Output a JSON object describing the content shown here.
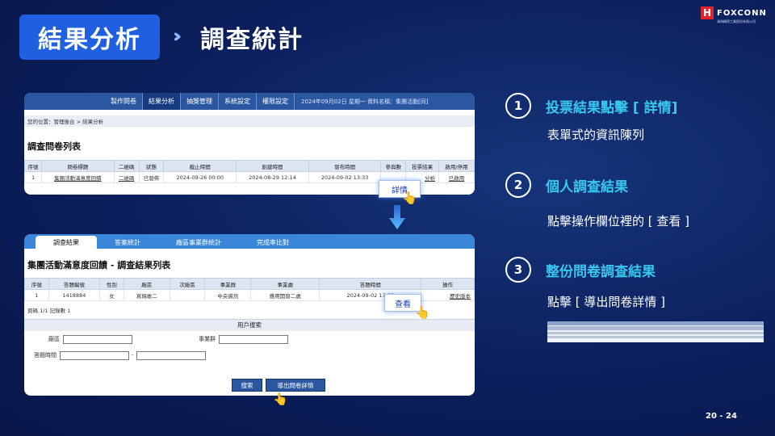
{
  "header": {
    "title": "結果分析",
    "subtitle": "調查統計",
    "logo_mark": "H",
    "logo_text": "FOXCONN",
    "logo_sub": "鴻海精密工業股份有限公司"
  },
  "panel1": {
    "nav": [
      "製作問卷",
      "結果分析",
      "抽獎管理",
      "系統設定",
      "權限設定"
    ],
    "info": "2024年09月02日 星期一  資料名稱：集團活動[同]",
    "breadcrumb": "您的位置：管理後台 > 結果分析",
    "section_title": "調查問卷列表",
    "columns": [
      "序號",
      "問卷標題",
      "二維碼",
      "狀態",
      "截止時間",
      "創建時間",
      "發布時間",
      "參與數",
      "投票結果",
      "啟用/停用"
    ],
    "row": [
      "1",
      "集團活動滿意度回饋",
      "二維碼",
      "已發佈",
      "2024-09-26 00:00",
      "2024-08-29 12:14",
      "2024-09-02 13:33",
      "",
      "分析",
      "已啟用"
    ],
    "callout": "詳情"
  },
  "panel2": {
    "tabs": [
      "調查結果",
      "答案統計",
      "廠區事業群統計",
      "完成率比對"
    ],
    "section_title": "集團活動滿意度回饋 - 調查結果列表",
    "columns": [
      "序號",
      "答題編號",
      "性別",
      "廠區",
      "次廠區",
      "事業群",
      "事業處",
      "答題時間",
      "操作"
    ],
    "row": [
      "1",
      "1418884",
      "女",
      "寫錫敢二",
      "",
      "中央資訊",
      "應用開發二處",
      "2024-09-02 17:39",
      "歷史版本"
    ],
    "record_count": "頁碼 1/1 記錄數 1",
    "search_title": "用戶搜索",
    "labels": {
      "id": "廠區",
      "unit": "事業群",
      "time": "答題時間"
    },
    "buttons": {
      "search": "搜索",
      "export": "導出問卷詳情"
    },
    "callout": "查看"
  },
  "steps": [
    {
      "num": "1",
      "title": "投票結果點擊 [ 詳情]",
      "desc": "表單式的資訊陳列"
    },
    {
      "num": "2",
      "title": "個人調查結果",
      "desc": "點擊操作欄位裡的 [ 查看 ]"
    },
    {
      "num": "3",
      "title": "整份問卷調查結果",
      "desc": "點擊 [ 導出問卷詳情 ]"
    }
  ],
  "page_number": "20 - 24",
  "colors": {
    "accent": "#36c8f0",
    "title_box": "#1f5fe0",
    "background": "#0b1f5c"
  }
}
